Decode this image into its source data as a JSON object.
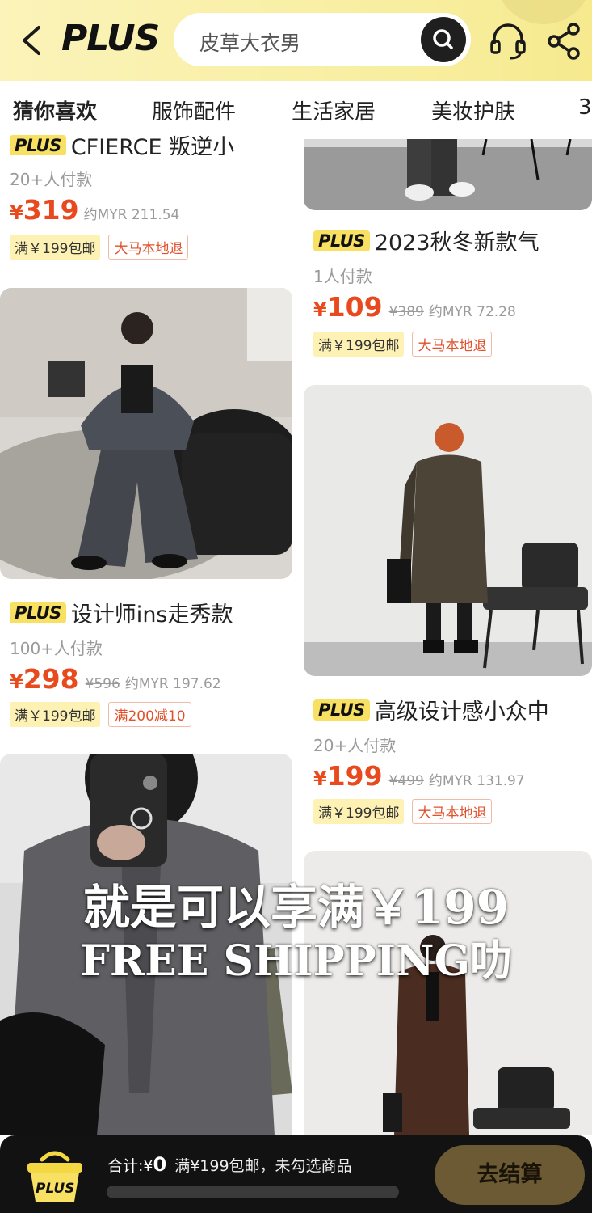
{
  "header": {
    "logo": "PLUS",
    "search_placeholder": "皮草大衣男"
  },
  "tabs": [
    "猜你喜欢",
    "服饰配件",
    "生活家居",
    "美妆护肤",
    "3"
  ],
  "products": [
    {
      "badge": "PLUS",
      "title": "CFIERCE 叛逆小",
      "sold": "20+人付款",
      "currency": "¥",
      "price": "319",
      "orig_price": "",
      "myr": "约MYR 211.54",
      "tag_shipping": "满￥199包邮",
      "tag_extra": "大马本地退"
    },
    {
      "badge": "PLUS",
      "title": "2023秋冬新款气",
      "sold": "1人付款",
      "currency": "¥",
      "price": "109",
      "orig_price": "¥389",
      "myr": "约MYR 72.28",
      "tag_shipping": "满￥199包邮",
      "tag_extra": "大马本地退"
    },
    {
      "badge": "PLUS",
      "title": "设计师ins走秀款",
      "sold": "100+人付款",
      "currency": "¥",
      "price": "298",
      "orig_price": "¥596",
      "myr": "约MYR 197.62",
      "tag_shipping": "满￥199包邮",
      "tag_extra": "满200减10"
    },
    {
      "badge": "PLUS",
      "title": "高级设计感小众中",
      "sold": "20+人付款",
      "currency": "¥",
      "price": "199",
      "orig_price": "¥499",
      "myr": "约MYR 131.97",
      "tag_shipping": "满￥199包邮",
      "tag_extra": "大马本地退"
    }
  ],
  "overlay_caption": {
    "line1": "就是可以享满￥199",
    "line2": "FREE SHIPPING叻"
  },
  "bottom_bar": {
    "cart_badge": "PLUS",
    "total_label": "合计:",
    "total_currency": "¥",
    "total_value": "0",
    "shipping_note": "满¥199包邮，未勾选商品",
    "checkout_label": "去结算"
  },
  "colors": {
    "price_red": "#e8491d",
    "plus_yellow": "#f7e062",
    "header_yellow": "#f8ee9f",
    "bottom_bar": "#121212",
    "checkout_gold": "#6b5a33"
  }
}
